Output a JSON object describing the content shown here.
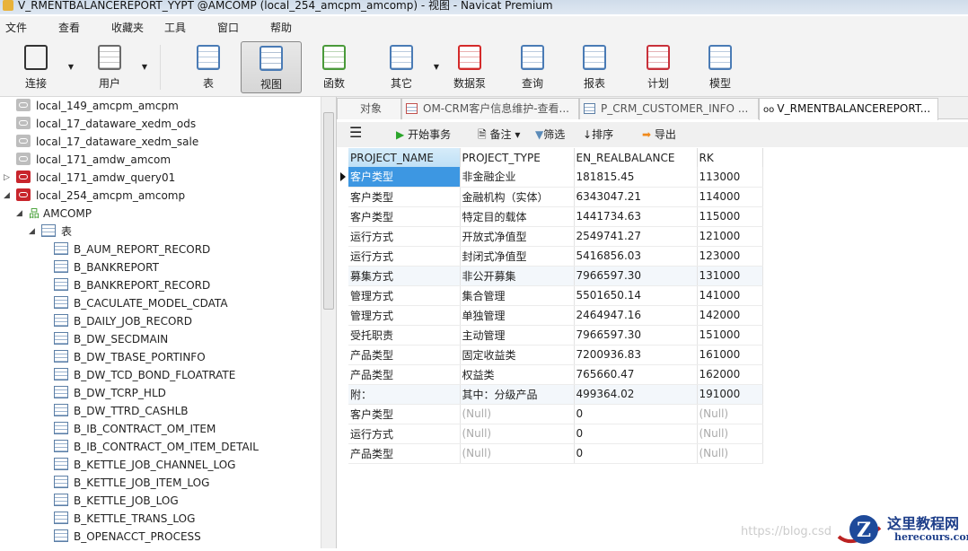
{
  "window": {
    "title": "V_RMENTBALANCEREPORT_YYPT @AMCOMP (local_254_amcpm_amcomp) - 视图 - Navicat Premium"
  },
  "menu": [
    "文件",
    "查看",
    "收藏夹",
    "工具",
    "窗口",
    "帮助"
  ],
  "toolbar": [
    {
      "label": "连接",
      "icon": "connection-icon"
    },
    {
      "label": "用户",
      "icon": "user-icon"
    },
    {
      "label": "表",
      "icon": "table-icon"
    },
    {
      "label": "视图",
      "icon": "view-icon"
    },
    {
      "label": "函数",
      "icon": "function-icon"
    },
    {
      "label": "其它",
      "icon": "other-icon"
    },
    {
      "label": "数据泵",
      "icon": "data-pump-icon"
    },
    {
      "label": "查询",
      "icon": "query-icon"
    },
    {
      "label": "报表",
      "icon": "report-icon"
    },
    {
      "label": "计划",
      "icon": "schedule-icon"
    },
    {
      "label": "模型",
      "icon": "model-icon"
    }
  ],
  "tree": {
    "connections": [
      "local_149_amcpm_amcpm",
      "local_17_dataware_xedm_ods",
      "local_17_dataware_xedm_sale",
      "local_171_amdw_amcom",
      "local_171_amdw_query01",
      "local_254_amcpm_amcomp"
    ],
    "schema": "AMCOMP",
    "tables_label": "表",
    "tables": [
      "B_AUM_REPORT_RECORD",
      "B_BANKREPORT",
      "B_BANKREPORT_RECORD",
      "B_CACULATE_MODEL_CDATA",
      "B_DAILY_JOB_RECORD",
      "B_DW_SECDMAIN",
      "B_DW_TBASE_PORTINFO",
      "B_DW_TCD_BOND_FLOATRATE",
      "B_DW_TCRP_HLD",
      "B_DW_TTRD_CASHLB",
      "B_IB_CONTRACT_OM_ITEM",
      "B_IB_CONTRACT_OM_ITEM_DETAIL",
      "B_KETTLE_JOB_CHANNEL_LOG",
      "B_KETTLE_JOB_ITEM_LOG",
      "B_KETTLE_JOB_LOG",
      "B_KETTLE_TRANS_LOG",
      "B_OPENACCT_PROCESS"
    ]
  },
  "tabs": [
    "对象",
    "OM-CRM客户信息维护-查看...",
    "P_CRM_CUSTOMER_INFO ...",
    "V_RMENTBALANCEREPORT..."
  ],
  "grid_toolbar": {
    "begin_tx": "开始事务",
    "note": "备注",
    "filter": "筛选",
    "sort": "排序",
    "export": "导出"
  },
  "grid": {
    "columns": [
      "PROJECT_NAME",
      "PROJECT_TYPE",
      "EN_REALBALANCE",
      "RK"
    ],
    "rows": [
      [
        "客户类型",
        "非金融企业",
        "181815.45",
        "113000"
      ],
      [
        "客户类型",
        "金融机构（实体）",
        "6343047.21",
        "114000"
      ],
      [
        "客户类型",
        "特定目的载体",
        "1441734.63",
        "115000"
      ],
      [
        "运行方式",
        "开放式净值型",
        "2549741.27",
        "121000"
      ],
      [
        "运行方式",
        "封闭式净值型",
        "5416856.03",
        "123000"
      ],
      [
        "募集方式",
        "非公开募集",
        "7966597.30",
        "131000"
      ],
      [
        "管理方式",
        "集合管理",
        "5501650.14",
        "141000"
      ],
      [
        "管理方式",
        "单独管理",
        "2464947.16",
        "142000"
      ],
      [
        "受托职责",
        "主动管理",
        "7966597.30",
        "151000"
      ],
      [
        "产品类型",
        "固定收益类",
        "7200936.83",
        "161000"
      ],
      [
        "产品类型",
        "权益类",
        "765660.47",
        "162000"
      ],
      [
        "附：",
        "其中：分级产品",
        "499364.02",
        "191000"
      ],
      [
        "客户类型",
        "(Null)",
        "0",
        "(Null)"
      ],
      [
        "运行方式",
        "(Null)",
        "0",
        "(Null)"
      ],
      [
        "产品类型",
        "(Null)",
        "0",
        "(Null)"
      ]
    ]
  },
  "watermark": "https://blog.csd",
  "logo": {
    "name": "这里教程网",
    "domain": "herecours.com"
  }
}
